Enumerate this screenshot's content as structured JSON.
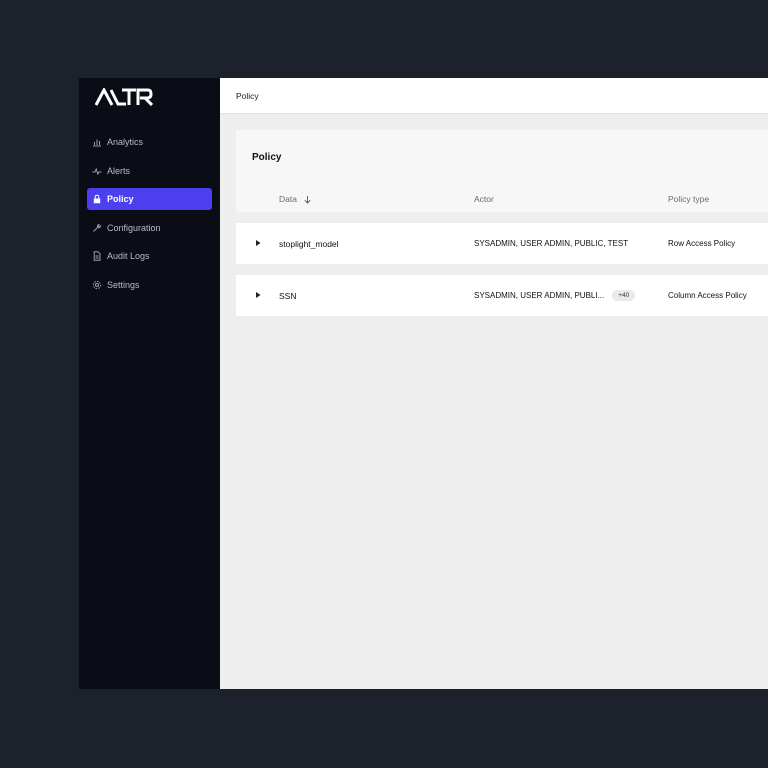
{
  "brand": {
    "logo_text": "ALTR"
  },
  "sidebar": {
    "items": [
      {
        "label": "Analytics",
        "icon": "bar-chart-icon",
        "active": false
      },
      {
        "label": "Alerts",
        "icon": "pulse-icon",
        "active": false
      },
      {
        "label": "Policy",
        "icon": "lock-icon",
        "active": true
      },
      {
        "label": "Configuration",
        "icon": "wrench-icon",
        "active": false
      },
      {
        "label": "Audit Logs",
        "icon": "document-icon",
        "active": false
      },
      {
        "label": "Settings",
        "icon": "gear-icon",
        "active": false
      }
    ]
  },
  "topbar": {
    "breadcrumb": "Policy"
  },
  "panel": {
    "title": "Policy",
    "columns": [
      "Data",
      "Actor",
      "Policy type"
    ],
    "rows": [
      {
        "data": "stoplight_model",
        "actor": "SYSADMIN, USER ADMIN, PUBLIC, TEST",
        "badge": "",
        "policy_type": "Row Access Policy"
      },
      {
        "data": "SSN",
        "actor": "SYSADMIN, USER ADMIN, PUBLI...",
        "badge": "+40",
        "policy_type": "Column Access Policy"
      }
    ]
  },
  "colors": {
    "background": "#1d212b",
    "sidebar": "#0a0c16",
    "accent": "#4c3ff0",
    "content": "#eeeeee"
  }
}
